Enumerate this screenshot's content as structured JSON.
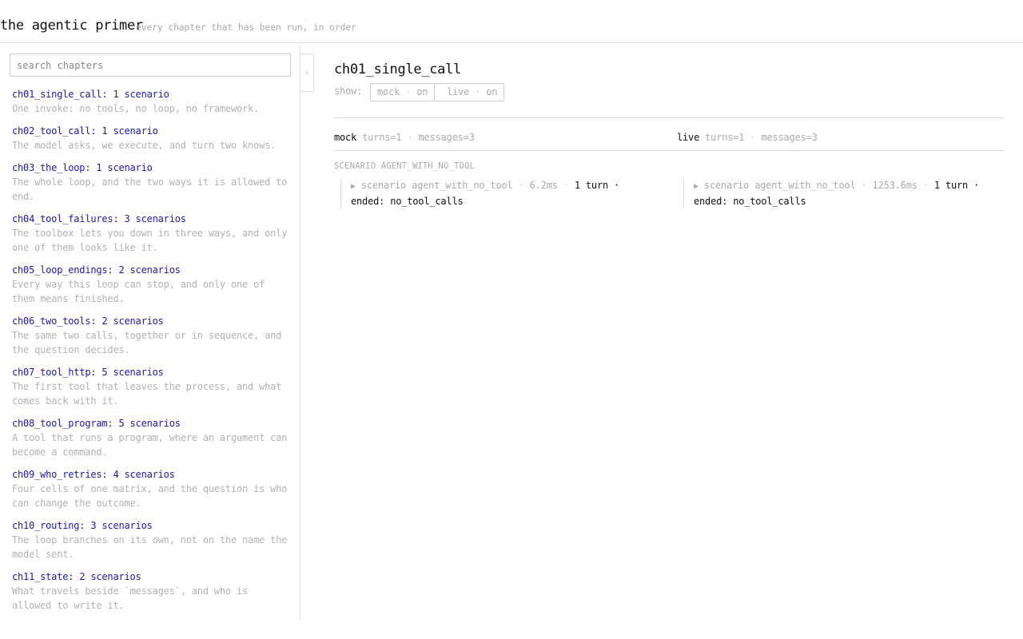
{
  "header": {
    "title": "the agentic primer",
    "subtitle": "every chapter that has been run, in order"
  },
  "sidebar": {
    "search_placeholder": "search chapters",
    "collapse_icon": "‹",
    "chapters": [
      {
        "title": "ch01_single_call: 1 scenario",
        "description": "One invoke: no tools, no loop, no framework."
      },
      {
        "title": "ch02_tool_call: 1 scenario",
        "description": "The model asks, we execute, and turn two knows."
      },
      {
        "title": "ch03_the_loop: 1 scenario",
        "description": "The whole loop, and the two ways it is allowed to end."
      },
      {
        "title": "ch04_tool_failures: 3 scenarios",
        "description": "The toolbox lets you down in three ways, and only one of them looks like it."
      },
      {
        "title": "ch05_loop_endings: 2 scenarios",
        "description": "Every way this loop can stop, and only one of them means finished."
      },
      {
        "title": "ch06_two_tools: 2 scenarios",
        "description": "The same two calls, together or in sequence, and the question decides."
      },
      {
        "title": "ch07_tool_http: 5 scenarios",
        "description": "The first tool that leaves the process, and what comes back with it."
      },
      {
        "title": "ch08_tool_program: 5 scenarios",
        "description": "A tool that runs a program, where an argument can become a command."
      },
      {
        "title": "ch09_who_retries: 4 scenarios",
        "description": "Four cells of one matrix, and the question is who can change the outcome."
      },
      {
        "title": "ch10_routing: 3 scenarios",
        "description": "The loop branches on its own, not on the name the model sent."
      },
      {
        "title": "ch11_state: 2 scenarios",
        "description": "What travels beside `messages`, and who is allowed to write it."
      }
    ]
  },
  "main": {
    "title": "ch01_single_call",
    "show_label": "show:",
    "toggles": [
      {
        "name": "mock",
        "sep": "·",
        "state": "on"
      },
      {
        "name": "live",
        "sep": "·",
        "state": "on"
      }
    ],
    "columns": [
      {
        "name": "mock",
        "turns": "turns=1",
        "sep": "·",
        "messages": "messages=3"
      },
      {
        "name": "live",
        "turns": "turns=1",
        "sep": "·",
        "messages": "messages=3"
      }
    ],
    "scenario_label": "SCENARIO AGENT_WITH_NO_TOOL",
    "runs": [
      {
        "arrow": "▶",
        "label": "scenario agent_with_no_tool",
        "sep": "·",
        "time": "6.2ms",
        "turns": "1 turn",
        "ended": "ended:",
        "result": "no_tool_calls"
      },
      {
        "arrow": "▶",
        "label": "scenario agent_with_no_tool",
        "sep": "·",
        "time": "1253.6ms",
        "turns": "1 turn",
        "ended": "ended:",
        "result": "no_tool_calls"
      }
    ]
  }
}
